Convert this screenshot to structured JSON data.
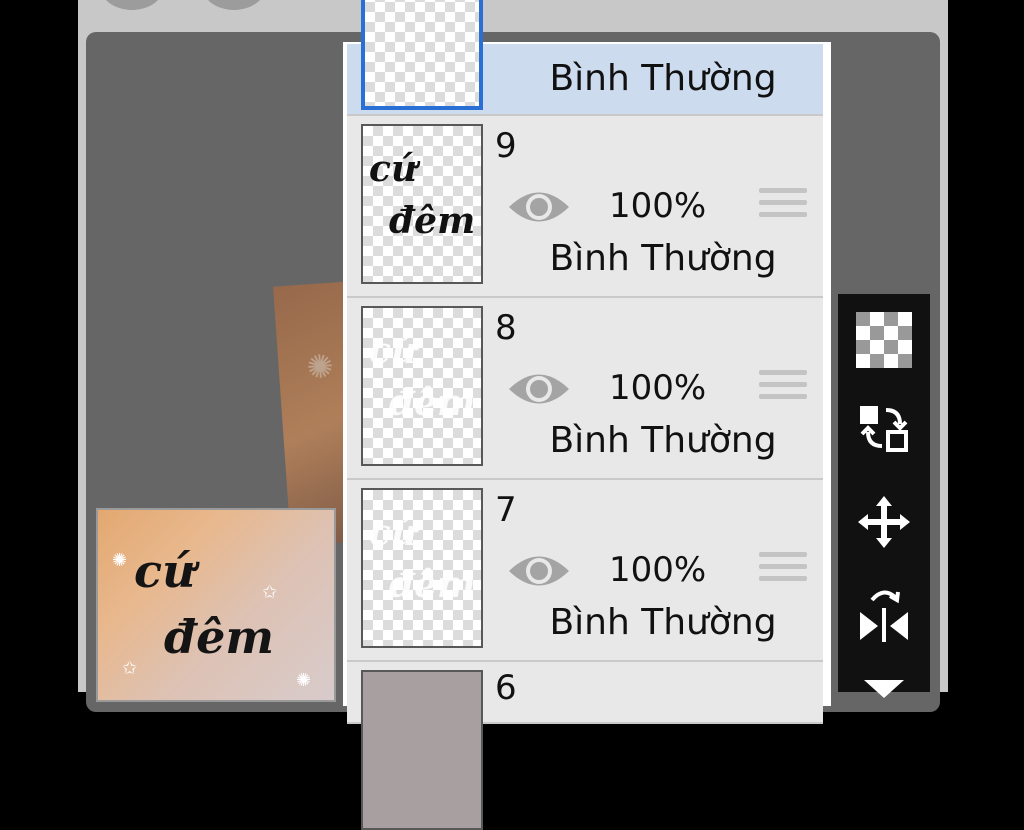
{
  "layers": [
    {
      "number": "",
      "opacity": "",
      "blend": "Bình Thường",
      "selected": true
    },
    {
      "number": "9",
      "opacity": "100%",
      "blend": "Bình Thường"
    },
    {
      "number": "8",
      "opacity": "100%",
      "blend": "Bình Thường"
    },
    {
      "number": "7",
      "opacity": "100%",
      "blend": "Bình Thường"
    },
    {
      "number": "6",
      "opacity": "",
      "blend": ""
    }
  ],
  "thumb_text": {
    "line1": "cứ",
    "line2": "đêm"
  },
  "preview_text": {
    "line1": "cứ",
    "line2": "đêm"
  },
  "toolbar": [
    "transparency-icon",
    "swap-icon",
    "move-icon",
    "flip-icon",
    "dropdown-icon"
  ],
  "colors": {
    "selected_bg": "#cddbee",
    "selected_border": "#2a6fd6",
    "toolbar_bg": "#111111",
    "canvas_bg": "#666666"
  }
}
